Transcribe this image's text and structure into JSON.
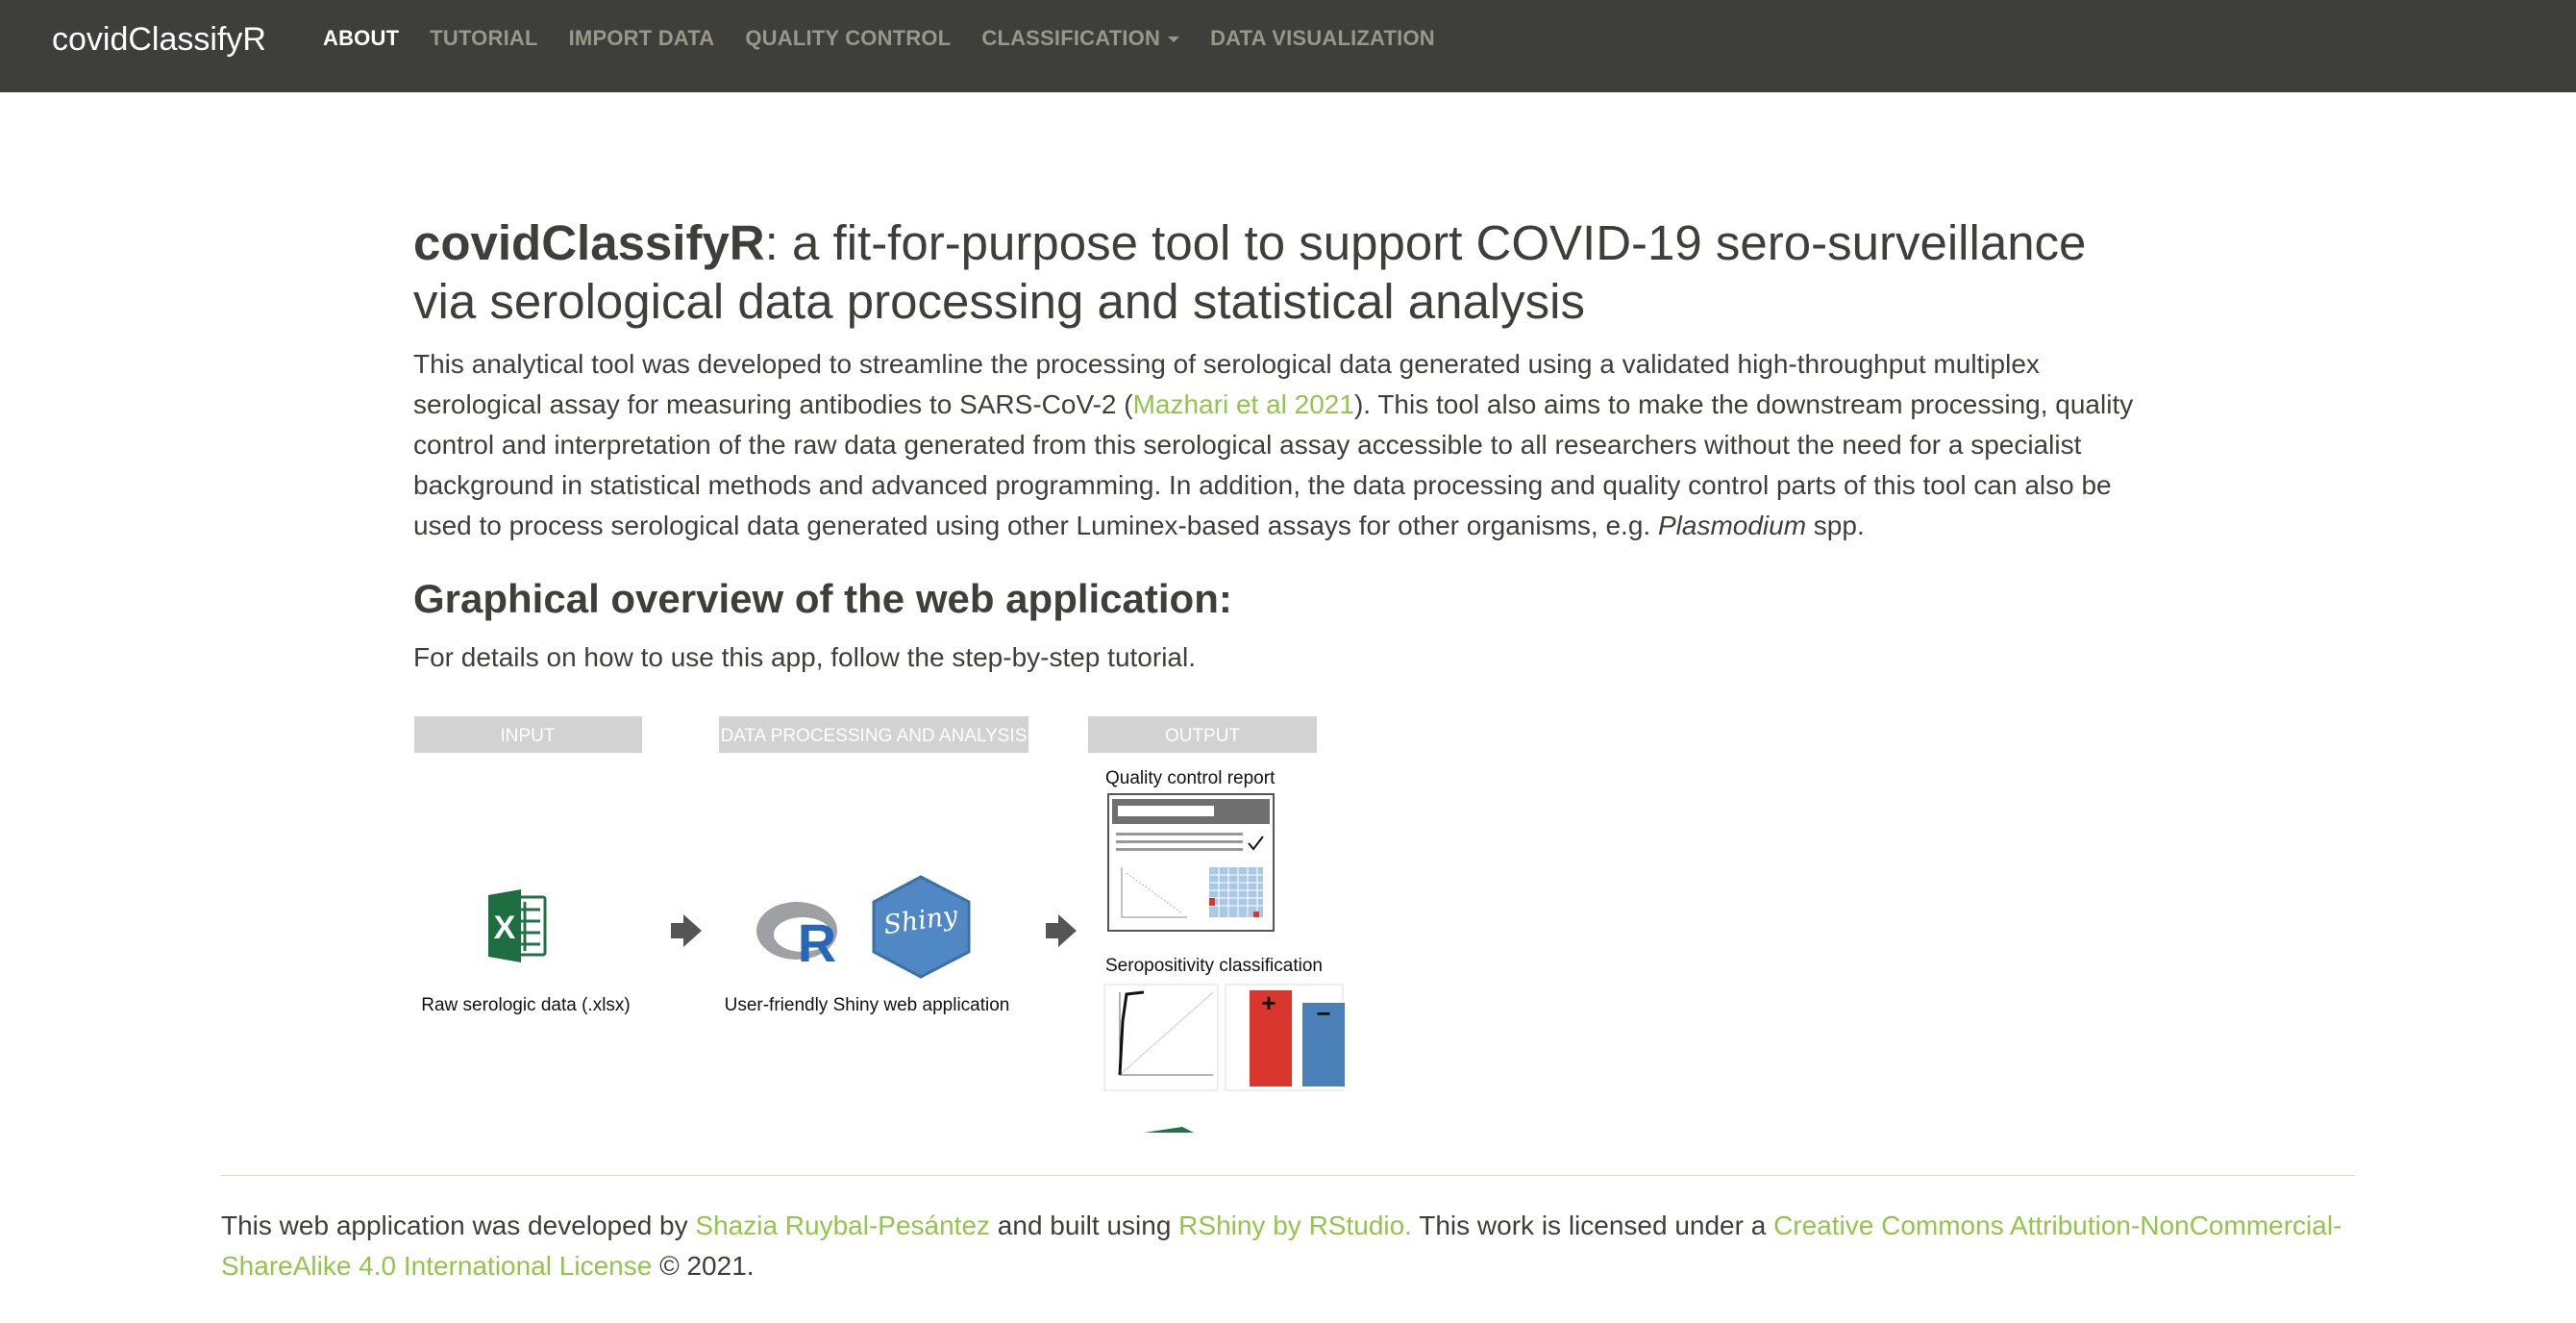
{
  "navbar": {
    "brand": "covidClassifyR",
    "items": [
      {
        "label": "ABOUT"
      },
      {
        "label": "TUTORIAL"
      },
      {
        "label": "IMPORT DATA"
      },
      {
        "label": "QUALITY CONTROL"
      },
      {
        "label": "CLASSIFICATION"
      },
      {
        "label": "DATA VISUALIZATION"
      }
    ],
    "active_color": "#ffffff",
    "inactive_color": "#98978b",
    "background": "#3e3f3a"
  },
  "main": {
    "title_bold": "covidClassifyR",
    "title_rest": ": a fit-for-purpose tool to support COVID-19 sero-surveillance via serological data processing and statistical analysis",
    "intro_part1": "This analytical tool was developed to streamline the processing of serological data generated using a validated high-throughput multiplex serological assay for measuring antibodies to SARS-CoV-2 (",
    "intro_link": "Mazhari et al 2021",
    "intro_part2": "). This tool also aims to make the downstream processing, quality control and interpretation of the raw data generated from this serological assay accessible to all researchers without the need for a specialist background in statistical methods and advanced programming. In addition, the data processing and quality control parts of this tool can also be used to process serological data generated using other Luminex-based assays for other organisms, e.g. ",
    "intro_italic": "Plasmodium",
    "intro_part3": " spp.",
    "overview_heading": "Graphical overview of the web application:",
    "overview_text": "For details on how to use this app, follow the step-by-step tutorial.",
    "link_color": "#93c54b"
  },
  "figure": {
    "input_label": "INPUT",
    "processing_label": "DATA PROCESSING AND ANALYSIS",
    "output_label": "OUTPUT",
    "input_caption": "Raw serologic data (.xlsx)",
    "processing_caption": "User-friendly Shiny web application",
    "qc_report_label": "Quality control report",
    "sero_label": "Seropositivity classification",
    "excel_letter": "X",
    "r_letter": "R",
    "shiny_text": "Shiny",
    "plus_sign": "+",
    "minus_sign": "−",
    "bar_positive_color": "#d9372e",
    "bar_negative_color": "#4a7fb8"
  },
  "footer": {
    "part1": "This web application was developed by ",
    "author_link": "Shazia Ruybal-Pesántez",
    "part2": " and built using ",
    "rshiny_link": "RShiny by RStudio.",
    "part3": " This work is licensed under a ",
    "license_link": "Creative Commons Attribution-NonCommercial-ShareAlike 4.0 International License",
    "part4": " © 2021."
  }
}
